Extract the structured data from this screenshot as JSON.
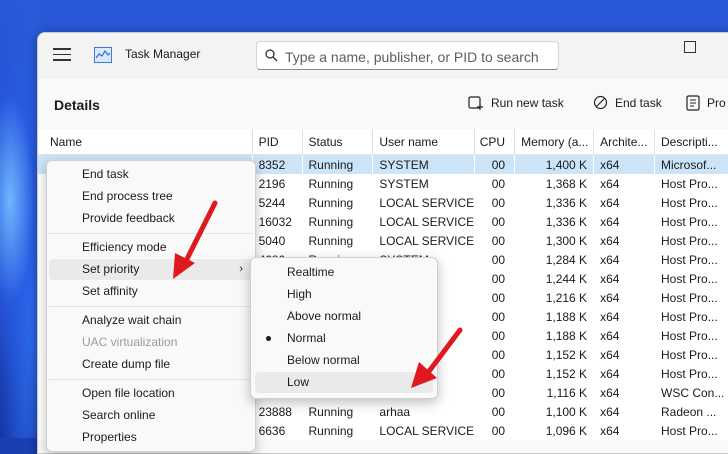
{
  "window": {
    "title": "Task Manager",
    "search_placeholder": "Type a name, publisher, or PID to search"
  },
  "page": {
    "title": "Details",
    "commands": [
      {
        "label": "Run new task",
        "icon": "run-task-icon"
      },
      {
        "label": "End task",
        "icon": "end-task-icon"
      },
      {
        "label": "Pro",
        "icon": "properties-icon"
      }
    ]
  },
  "table": {
    "columns": [
      "Name",
      "PID",
      "Status",
      "User name",
      "CPU",
      "Memory (a...",
      "Archite...",
      "Descripti..."
    ],
    "rows": [
      {
        "pid": "8352",
        "status": "Running",
        "user": "SYSTEM",
        "cpu": "00",
        "mem": "1,400 K",
        "arch": "x64",
        "desc": "Microsof..."
      },
      {
        "pid": "2196",
        "status": "Running",
        "user": "SYSTEM",
        "cpu": "00",
        "mem": "1,368 K",
        "arch": "x64",
        "desc": "Host Pro..."
      },
      {
        "pid": "5244",
        "status": "Running",
        "user": "LOCAL SERVICE",
        "cpu": "00",
        "mem": "1,336 K",
        "arch": "x64",
        "desc": "Host Pro..."
      },
      {
        "pid": "16032",
        "status": "Running",
        "user": "LOCAL SERVICE",
        "cpu": "00",
        "mem": "1,336 K",
        "arch": "x64",
        "desc": "Host Pro..."
      },
      {
        "pid": "5040",
        "status": "Running",
        "user": "LOCAL SERVICE",
        "cpu": "00",
        "mem": "1,300 K",
        "arch": "x64",
        "desc": "Host Pro..."
      },
      {
        "pid": "4680",
        "status": "Running",
        "user": "SYSTEM",
        "cpu": "00",
        "mem": "1,284 K",
        "arch": "x64",
        "desc": "Host Pro..."
      },
      {
        "pid": "",
        "status": "",
        "user": "SERVICE",
        "cpu": "00",
        "mem": "1,244 K",
        "arch": "x64",
        "desc": "Host Pro..."
      },
      {
        "pid": "",
        "status": "",
        "user": "SERVICE",
        "cpu": "00",
        "mem": "1,216 K",
        "arch": "x64",
        "desc": "Host Pro..."
      },
      {
        "pid": "",
        "status": "",
        "user": "SERVICE",
        "cpu": "00",
        "mem": "1,188 K",
        "arch": "x64",
        "desc": "Host Pro..."
      },
      {
        "pid": "",
        "status": "",
        "user": "",
        "cpu": "00",
        "mem": "1,188 K",
        "arch": "x64",
        "desc": "Host Pro..."
      },
      {
        "pid": "",
        "status": "",
        "user": "SERVICE",
        "cpu": "00",
        "mem": "1,152 K",
        "arch": "x64",
        "desc": "Host Pro..."
      },
      {
        "pid": "",
        "status": "",
        "user": "SERVICE",
        "cpu": "00",
        "mem": "1,152 K",
        "arch": "x64",
        "desc": "Host Pro..."
      },
      {
        "pid": "",
        "status": "",
        "user": "",
        "cpu": "00",
        "mem": "1,116 K",
        "arch": "x64",
        "desc": "WSC Con..."
      },
      {
        "pid": "23888",
        "status": "Running",
        "user": "arhaa",
        "cpu": "00",
        "mem": "1,100 K",
        "arch": "x64",
        "desc": "Radeon ..."
      },
      {
        "pid": "6636",
        "status": "Running",
        "user": "LOCAL SERVICE",
        "cpu": "00",
        "mem": "1,096 K",
        "arch": "x64",
        "desc": "Host Pro..."
      }
    ]
  },
  "context_menu": {
    "end_task": "End task",
    "end_process_tree": "End process tree",
    "provide_feedback": "Provide feedback",
    "efficiency_mode": "Efficiency mode",
    "set_priority": "Set priority",
    "set_affinity": "Set affinity",
    "analyze_wait_chain": "Analyze wait chain",
    "uac_virtualization": "UAC virtualization",
    "create_dump_file": "Create dump file",
    "open_file_location": "Open file location",
    "search_online": "Search online",
    "properties": "Properties"
  },
  "priority_menu": {
    "items": [
      "Realtime",
      "High",
      "Above normal",
      "Normal",
      "Below normal",
      "Low"
    ],
    "selected": "Normal",
    "highlighted": "Low"
  },
  "colors": {
    "selection": "#cce4f7",
    "annotation_arrow": "#e0191e"
  }
}
